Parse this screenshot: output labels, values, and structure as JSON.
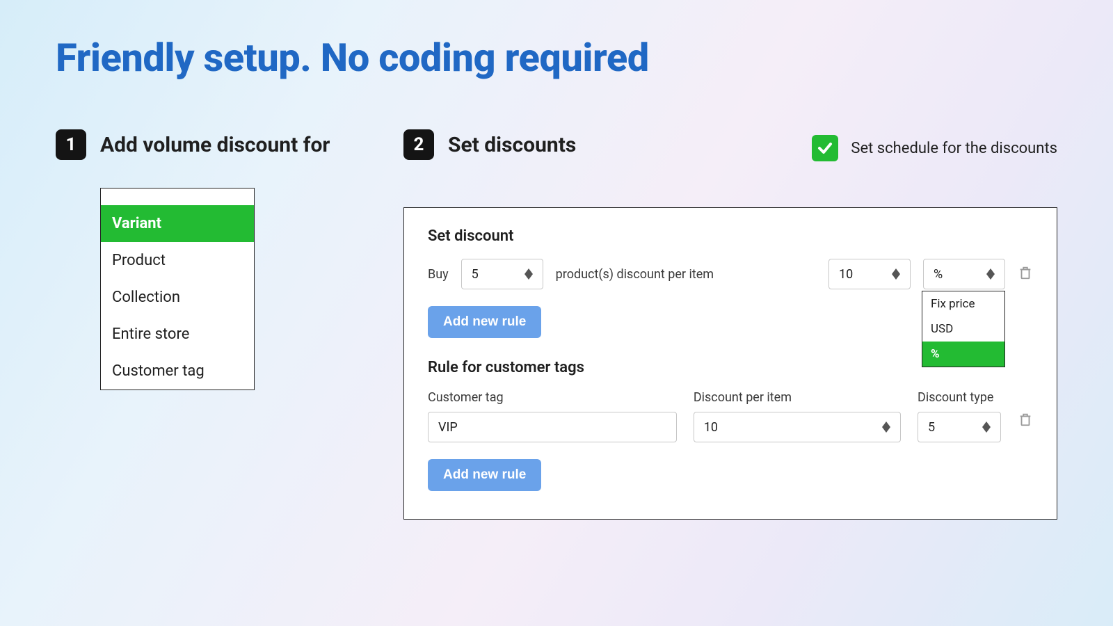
{
  "title": "Friendly setup. No coding required",
  "step1": {
    "num": "1",
    "title": "Add volume discount for",
    "options": [
      "Variant",
      "Product",
      "Collection",
      "Entire store",
      "Customer tag"
    ],
    "selected": "Variant"
  },
  "step2": {
    "num": "2",
    "title": "Set discounts"
  },
  "schedule": {
    "checked": true,
    "label": "Set schedule for the discounts"
  },
  "discount": {
    "section_title": "Set discount",
    "buy_label": "Buy",
    "buy_qty": "5",
    "per_item_label": "product(s) discount per item",
    "value": "10",
    "unit": "%",
    "add_rule": "Add new rule",
    "unit_options": [
      "Fix price",
      "USD",
      "%"
    ],
    "unit_selected": "%"
  },
  "customer_rule": {
    "section_title": "Rule for customer tags",
    "tag_label": "Customer tag",
    "tag_value": "VIP",
    "per_item_label": "Discount per item",
    "per_item_value": "10",
    "type_label": "Discount type",
    "type_value": "5",
    "add_rule": "Add new rule"
  }
}
